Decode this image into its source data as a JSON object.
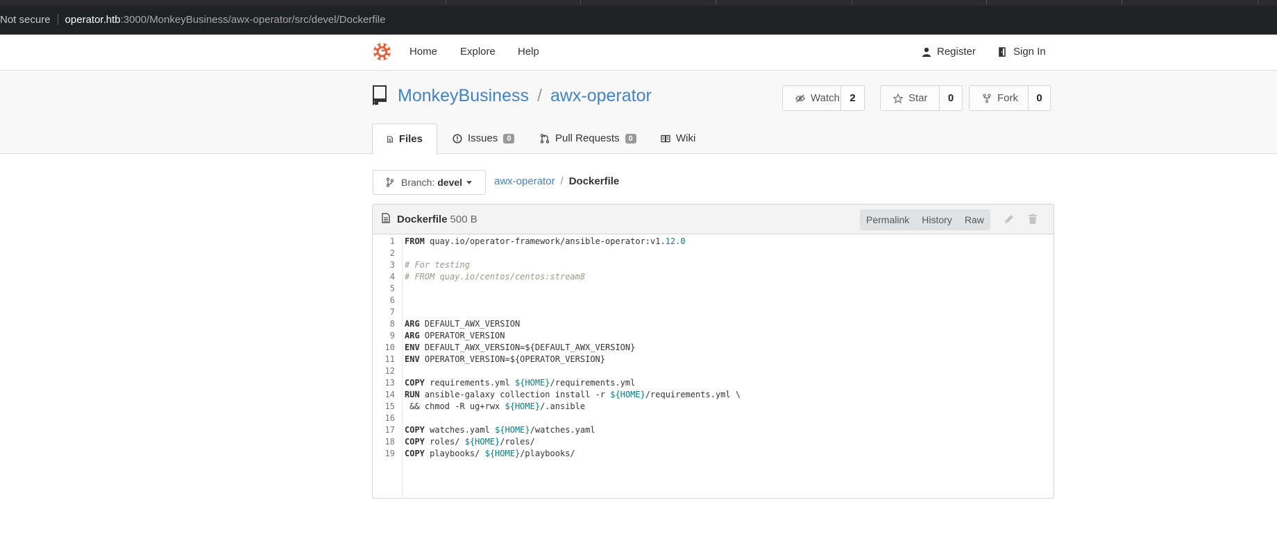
{
  "browser": {
    "not_secure": "Not secure",
    "url_host": "operator.htb",
    "url_path": ":3000/MonkeyBusiness/awx-operator/src/devel/Dockerfile"
  },
  "nav": {
    "home": "Home",
    "explore": "Explore",
    "help": "Help",
    "register": "Register",
    "sign_in": "Sign In"
  },
  "repo": {
    "owner": "MonkeyBusiness",
    "slash": "/",
    "name": "awx-operator",
    "watch_label": "Watch",
    "watch_count": "2",
    "star_label": "Star",
    "star_count": "0",
    "fork_label": "Fork",
    "fork_count": "0"
  },
  "tabs": {
    "files": "Files",
    "issues": "Issues",
    "issues_count": "0",
    "pulls": "Pull Requests",
    "pulls_count": "0",
    "wiki": "Wiki"
  },
  "branch": {
    "prefix": "Branch:",
    "name": "devel"
  },
  "breadcrumb": {
    "repo": "awx-operator",
    "sep": "/",
    "file": "Dockerfile"
  },
  "file": {
    "name": "Dockerfile",
    "size": "500 B",
    "permalink": "Permalink",
    "history": "History",
    "raw": "Raw"
  },
  "code_lines": [
    {
      "n": "1",
      "kw": "FROM",
      "text": " quay.io/operator-framework/ansible-operator:v1.",
      "var": "12.0",
      "rest": ""
    },
    {
      "n": "2",
      "kw": "",
      "text": "",
      "var": "",
      "rest": ""
    },
    {
      "n": "3",
      "comment": "# For testing"
    },
    {
      "n": "4",
      "comment": "# FROM quay.io/centos/centos:stream8"
    },
    {
      "n": "5",
      "kw": "",
      "text": "",
      "var": "",
      "rest": ""
    },
    {
      "n": "6",
      "kw": "",
      "text": "",
      "var": "",
      "rest": ""
    },
    {
      "n": "7",
      "kw": "",
      "text": "",
      "var": "",
      "rest": ""
    },
    {
      "n": "8",
      "kw": "ARG",
      "text": " DEFAULT_AWX_VERSION",
      "var": "",
      "rest": ""
    },
    {
      "n": "9",
      "kw": "ARG",
      "text": " OPERATOR_VERSION",
      "var": "",
      "rest": ""
    },
    {
      "n": "10",
      "kw": "ENV",
      "text": " DEFAULT_AWX_VERSION=${DEFAULT_AWX_VERSION}",
      "var": "",
      "rest": ""
    },
    {
      "n": "11",
      "kw": "ENV",
      "text": " OPERATOR_VERSION=${OPERATOR_VERSION}",
      "var": "",
      "rest": ""
    },
    {
      "n": "12",
      "kw": "",
      "text": "",
      "var": "",
      "rest": ""
    },
    {
      "n": "13",
      "kw": "COPY",
      "text": " requirements.yml ",
      "var": "${HOME}",
      "rest": "/requirements.yml"
    },
    {
      "n": "14",
      "kw": "RUN",
      "text": " ansible-galaxy collection install -r ",
      "var": "${HOME}",
      "rest": "/requirements.yml \\"
    },
    {
      "n": "15",
      "kw": "",
      "text": " && chmod -R ug+rwx ",
      "var": "${HOME}",
      "rest": "/.ansible"
    },
    {
      "n": "16",
      "kw": "",
      "text": "",
      "var": "",
      "rest": ""
    },
    {
      "n": "17",
      "kw": "COPY",
      "text": " watches.yaml ",
      "var": "${HOME}",
      "rest": "/watches.yaml"
    },
    {
      "n": "18",
      "kw": "COPY",
      "text": " roles/ ",
      "var": "${HOME}",
      "rest": "/roles/"
    },
    {
      "n": "19",
      "kw": "COPY",
      "text": " playbooks/ ",
      "var": "${HOME}",
      "rest": "/playbooks/"
    }
  ]
}
